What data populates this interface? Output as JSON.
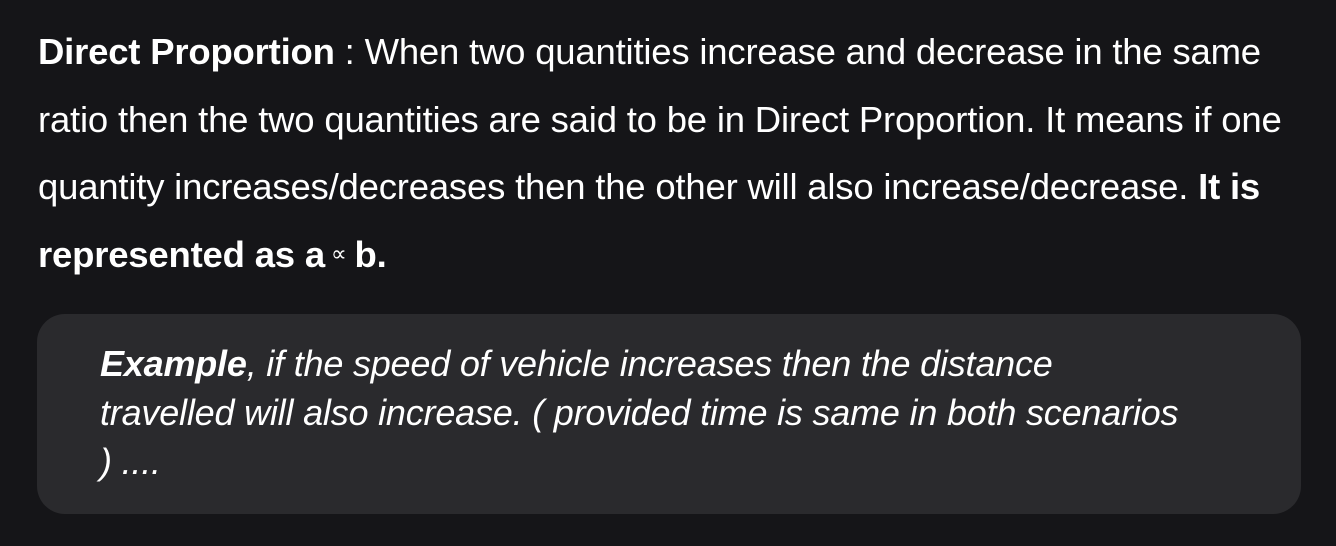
{
  "definition": {
    "term": "Direct Proportion",
    "colon": " : ",
    "body": "When two quantities increase and decrease in the same ratio then the two quantities are said to be in Direct Proportion. It means if one quantity increases/decreases then the other will also increase/decrease. ",
    "representation_prefix": "It is represented as a",
    "symbol": "∝",
    "representation_suffix": "b."
  },
  "example": {
    "label": "Example",
    "text": ", if the speed of vehicle increases then the distance travelled will also increase. ( provided time is same in both scenarios ) ...."
  }
}
